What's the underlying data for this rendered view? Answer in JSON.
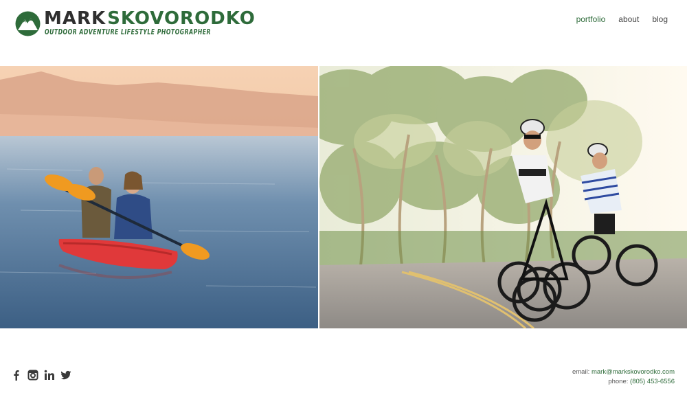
{
  "brand": {
    "first": "MARK",
    "last": "SKOVORODKO",
    "tagline": "OUTDOOR ADVENTURE LIFESTYLE PHOTOGRAPHER"
  },
  "nav": {
    "items": [
      {
        "label": "portfolio",
        "active": true
      },
      {
        "label": "about",
        "active": false
      },
      {
        "label": "blog",
        "active": false
      }
    ]
  },
  "footer": {
    "email_label": "email:",
    "email": "mark@markskovorodko.com",
    "phone_label": "phone:",
    "phone": "(805) 453-6556"
  },
  "social": [
    "facebook-icon",
    "instagram-icon",
    "linkedin-icon",
    "twitter-icon"
  ],
  "colors": {
    "accent": "#2e6b3a",
    "text": "#444444"
  }
}
